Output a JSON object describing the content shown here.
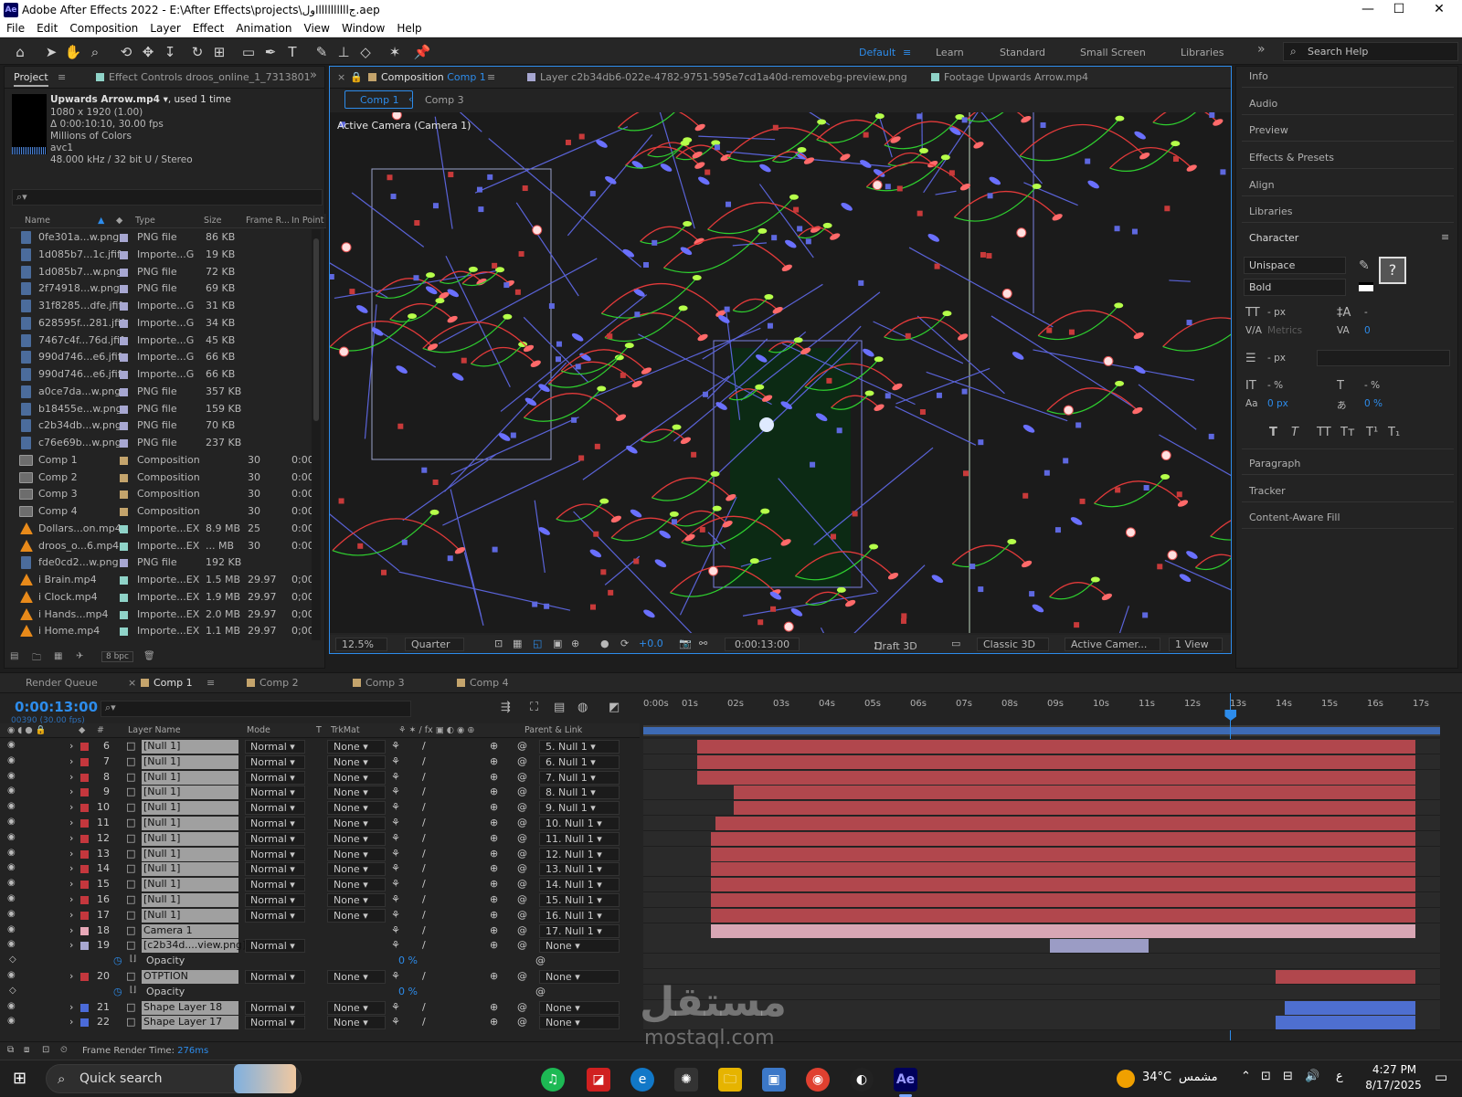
{
  "titlebar": {
    "title": "Adobe After Effects 2022 - E:\\After Effects\\projects\\اولllllllllllج.aep",
    "app_badge": "Ae",
    "minimize": "—",
    "maximize": "☐",
    "close": "✕"
  },
  "menu": [
    "File",
    "Edit",
    "Composition",
    "Layer",
    "Effect",
    "Animation",
    "View",
    "Window",
    "Help"
  ],
  "workspaces": [
    {
      "label": "Default",
      "active": true
    },
    {
      "label": "Learn"
    },
    {
      "label": "Standard"
    },
    {
      "label": "Small Screen"
    },
    {
      "label": "Libraries"
    }
  ],
  "search_help": "Search Help",
  "project": {
    "tab_project": "Project",
    "tab_effects": "Effect Controls droos_online_1_7313801",
    "selected_name": "Upwards Arrow.mp4",
    "used": ", used 1 time",
    "info": [
      "1080 x 1920 (1.00)",
      "Δ 0:00:10:10, 30.00 fps",
      "Millions of Colors",
      "avc1",
      "48.000 kHz / 32 bit U / Stereo"
    ],
    "columns": {
      "name": "Name",
      "type": "Type",
      "size": "Size",
      "frame": "Frame R...",
      "inpoint": "In Point"
    },
    "items": [
      {
        "name": "0fe301a...w.png",
        "type": "PNG file",
        "size": "86 KB",
        "frame": "",
        "inpoint": "",
        "kind": "png",
        "color": "#a7a7d1"
      },
      {
        "name": "1d085b7...1c.jfif",
        "type": "Importe...G",
        "size": "19 KB",
        "frame": "",
        "inpoint": "",
        "kind": "png",
        "color": "#a7a7d1"
      },
      {
        "name": "1d085b7...w.png",
        "type": "PNG file",
        "size": "72 KB",
        "frame": "",
        "inpoint": "",
        "kind": "png",
        "color": "#a7a7d1"
      },
      {
        "name": "2f74918...w.png",
        "type": "PNG file",
        "size": "69 KB",
        "frame": "",
        "inpoint": "",
        "kind": "png",
        "color": "#a7a7d1"
      },
      {
        "name": "31f8285...dfe.jfif",
        "type": "Importe...G",
        "size": "31 KB",
        "frame": "",
        "inpoint": "",
        "kind": "png",
        "color": "#a7a7d1"
      },
      {
        "name": "628595f...281.jfif",
        "type": "Importe...G",
        "size": "34 KB",
        "frame": "",
        "inpoint": "",
        "kind": "png",
        "color": "#a7a7d1"
      },
      {
        "name": "7467c4f...76d.jfif",
        "type": "Importe...G",
        "size": "45 KB",
        "frame": "",
        "inpoint": "",
        "kind": "png",
        "color": "#a7a7d1"
      },
      {
        "name": "990d746...e6.jfif",
        "type": "Importe...G",
        "size": "66 KB",
        "frame": "",
        "inpoint": "",
        "kind": "png",
        "color": "#a7a7d1"
      },
      {
        "name": "990d746...e6.jfif",
        "type": "Importe...G",
        "size": "66 KB",
        "frame": "",
        "inpoint": "",
        "kind": "png",
        "color": "#a7a7d1"
      },
      {
        "name": "a0ce7da...w.png",
        "type": "PNG file",
        "size": "357 KB",
        "frame": "",
        "inpoint": "",
        "kind": "png",
        "color": "#a7a7d1"
      },
      {
        "name": "b18455e...w.png",
        "type": "PNG file",
        "size": "159 KB",
        "frame": "",
        "inpoint": "",
        "kind": "png",
        "color": "#a7a7d1"
      },
      {
        "name": "c2b34db...w.png",
        "type": "PNG file",
        "size": "70 KB",
        "frame": "",
        "inpoint": "",
        "kind": "png",
        "color": "#a7a7d1"
      },
      {
        "name": "c76e69b...w.png",
        "type": "PNG file",
        "size": "237 KB",
        "frame": "",
        "inpoint": "",
        "kind": "png",
        "color": "#a7a7d1"
      },
      {
        "name": "Comp 1",
        "type": "Composition",
        "size": "",
        "frame": "30",
        "inpoint": "0:00",
        "kind": "comp",
        "color": "#c4a46c"
      },
      {
        "name": "Comp 2",
        "type": "Composition",
        "size": "",
        "frame": "30",
        "inpoint": "0:00",
        "kind": "comp",
        "color": "#c4a46c"
      },
      {
        "name": "Comp 3",
        "type": "Composition",
        "size": "",
        "frame": "30",
        "inpoint": "0:00",
        "kind": "comp",
        "color": "#c4a46c"
      },
      {
        "name": "Comp 4",
        "type": "Composition",
        "size": "",
        "frame": "30",
        "inpoint": "0:00",
        "kind": "comp",
        "color": "#c4a46c"
      },
      {
        "name": "Dollars...on.mp4",
        "type": "Importe...EX",
        "size": "8.9 MB",
        "frame": "25",
        "inpoint": "0:00",
        "kind": "vlc",
        "color": "#8fd3c8"
      },
      {
        "name": "droos_o...6.mp4",
        "type": "Importe...EX",
        "size": "... MB",
        "frame": "30",
        "inpoint": "0:00",
        "kind": "vlc",
        "color": "#8fd3c8"
      },
      {
        "name": "fde0cd2...w.png",
        "type": "PNG file",
        "size": "192 KB",
        "frame": "",
        "inpoint": "",
        "kind": "png",
        "color": "#a7a7d1"
      },
      {
        "name": "i Brain.mp4",
        "type": "Importe...EX",
        "size": "1.5 MB",
        "frame": "29.97",
        "inpoint": "0;00",
        "kind": "vlc",
        "color": "#8fd3c8"
      },
      {
        "name": "i Clock.mp4",
        "type": "Importe...EX",
        "size": "1.9 MB",
        "frame": "29.97",
        "inpoint": "0;00",
        "kind": "vlc",
        "color": "#8fd3c8"
      },
      {
        "name": "i Hands...mp4",
        "type": "Importe...EX",
        "size": "2.0 MB",
        "frame": "29.97",
        "inpoint": "0;00",
        "kind": "vlc",
        "color": "#8fd3c8"
      },
      {
        "name": "i Home.mp4",
        "type": "Importe...EX",
        "size": "1.1 MB",
        "frame": "29.97",
        "inpoint": "0;00",
        "kind": "vlc",
        "color": "#8fd3c8"
      }
    ],
    "bpc": "8 bpc"
  },
  "viewer": {
    "tab_comp_prefix": "Composition",
    "tab_comp_name": "Comp 1",
    "tab_layer": "Layer c2b34db6-022e-4782-9751-595e7cd1a40d-removebg-preview.png",
    "tab_footage": "Footage Upwards Arrow.mp4",
    "crumb_active": "Comp 1",
    "crumb_next": "Comp 3",
    "camera_label": "Active Camera (Camera 1)",
    "zoom": "12.5%",
    "resolution": "Quarter",
    "exposure": "+0.0",
    "time": "0:00:13:00",
    "draft3d": "Draft 3D",
    "renderer": "Classic 3D",
    "camera_view": "Active Camer...",
    "views": "1 View"
  },
  "right_panel": {
    "items_top": [
      "Info",
      "Audio",
      "Preview",
      "Effects & Presets",
      "Align",
      "Libraries",
      "Character"
    ],
    "font": "Unispace",
    "style": "Bold",
    "size": "- px",
    "leading": "-",
    "kerning": "Metrics",
    "tracking": "0",
    "stroke": "- px",
    "vscale": "- %",
    "hscale": "- %",
    "baseline": "0 px",
    "tsume": "0 %",
    "styles": [
      "T",
      "T",
      "TT",
      "Tт",
      "T¹",
      "T₁"
    ],
    "items_bottom": [
      "Paragraph",
      "Tracker",
      "Content-Aware Fill"
    ]
  },
  "timeline": {
    "tabs": [
      {
        "label": "Render Queue"
      },
      {
        "label": "Comp 1",
        "active": true
      },
      {
        "label": "Comp 2"
      },
      {
        "label": "Comp 3"
      },
      {
        "label": "Comp 4"
      }
    ],
    "timecode": "0:00:13:00",
    "frames": "00390 (30.00 fps)",
    "ticks": [
      "0:00s",
      "01s",
      "02s",
      "03s",
      "04s",
      "05s",
      "06s",
      "07s",
      "08s",
      "09s",
      "10s",
      "11s",
      "12s",
      "13s",
      "14s",
      "15s",
      "16s",
      "17s"
    ],
    "columns": {
      "hash": "#",
      "layer_name": "Layer Name",
      "mode": "Mode",
      "t": "T",
      "trkmat": "TrkMat",
      "parent": "Parent & Link"
    },
    "duration_seconds": 17.2,
    "playhead_seconds": 13,
    "layers": [
      {
        "num": "6",
        "name": "[Null 1]",
        "mode": "Normal",
        "trk": "None",
        "parent": "5. Null 1",
        "color": "#c4373d",
        "bar_color": "#b1474d",
        "start": 1.2,
        "end": 17.1
      },
      {
        "num": "7",
        "name": "[Null 1]",
        "mode": "Normal",
        "trk": "None",
        "parent": "6. Null 1",
        "color": "#c4373d",
        "bar_color": "#b1474d",
        "start": 1.2,
        "end": 17.1
      },
      {
        "num": "8",
        "name": "[Null 1]",
        "mode": "Normal",
        "trk": "None",
        "parent": "7. Null 1",
        "color": "#c4373d",
        "bar_color": "#b1474d",
        "start": 1.2,
        "end": 17.1
      },
      {
        "num": "9",
        "name": "[Null 1]",
        "mode": "Normal",
        "trk": "None",
        "parent": "8. Null 1",
        "color": "#c4373d",
        "bar_color": "#b1474d",
        "start": 2.0,
        "end": 17.1
      },
      {
        "num": "10",
        "name": "[Null 1]",
        "mode": "Normal",
        "trk": "None",
        "parent": "9. Null 1",
        "color": "#c4373d",
        "bar_color": "#b1474d",
        "start": 2.0,
        "end": 17.1
      },
      {
        "num": "11",
        "name": "[Null 1]",
        "mode": "Normal",
        "trk": "None",
        "parent": "10. Null 1",
        "color": "#c4373d",
        "bar_color": "#b1474d",
        "start": 1.6,
        "end": 17.1
      },
      {
        "num": "12",
        "name": "[Null 1]",
        "mode": "Normal",
        "trk": "None",
        "parent": "11. Null 1",
        "color": "#c4373d",
        "bar_color": "#b1474d",
        "start": 1.5,
        "end": 17.1
      },
      {
        "num": "13",
        "name": "[Null 1]",
        "mode": "Normal",
        "trk": "None",
        "parent": "12. Null 1",
        "color": "#c4373d",
        "bar_color": "#b1474d",
        "start": 1.5,
        "end": 17.1
      },
      {
        "num": "14",
        "name": "[Null 1]",
        "mode": "Normal",
        "trk": "None",
        "parent": "13. Null 1",
        "color": "#c4373d",
        "bar_color": "#b1474d",
        "start": 1.5,
        "end": 17.1
      },
      {
        "num": "15",
        "name": "[Null 1]",
        "mode": "Normal",
        "trk": "None",
        "parent": "14. Null 1",
        "color": "#c4373d",
        "bar_color": "#b1474d",
        "start": 1.5,
        "end": 17.1
      },
      {
        "num": "16",
        "name": "[Null 1]",
        "mode": "Normal",
        "trk": "None",
        "parent": "15. Null 1",
        "color": "#c4373d",
        "bar_color": "#b1474d",
        "start": 1.5,
        "end": 17.1
      },
      {
        "num": "17",
        "name": "[Null 1]",
        "mode": "Normal",
        "trk": "None",
        "parent": "16. Null 1",
        "color": "#c4373d",
        "bar_color": "#b1474d",
        "start": 1.5,
        "end": 17.1
      },
      {
        "num": "18",
        "name": "Camera 1",
        "mode": "",
        "trk": "",
        "parent": "17. Null 1",
        "color": "#e9a9b9",
        "bar_color": "#d8a6b4",
        "start": 1.5,
        "end": 17.1
      },
      {
        "num": "19",
        "name": "[c2b34d....view.png]",
        "mode": "Normal",
        "trk": "",
        "parent": "None",
        "color": "#a7a7d1",
        "bar_color": "#9b9cc5",
        "start": 9.0,
        "end": 11.2
      },
      {
        "prop": "Opacity",
        "value": "0 %"
      },
      {
        "num": "20",
        "name": "OTPTION",
        "mode": "Normal",
        "trk": "None",
        "parent": "None",
        "color": "#c4373d",
        "bar_color": "#b1474d",
        "start": 14.0,
        "end": 17.1
      },
      {
        "prop": "Opacity",
        "value": "0 %"
      },
      {
        "num": "21",
        "name": "Shape Layer 18",
        "mode": "Normal",
        "trk": "None",
        "parent": "None",
        "color": "#4b6bd8",
        "bar_color": "#4e6fd0",
        "start": 14.2,
        "end": 17.1
      },
      {
        "num": "22",
        "name": "Shape Layer 17",
        "mode": "Normal",
        "trk": "None",
        "parent": "None",
        "color": "#4b6bd8",
        "bar_color": "#4e6fd0",
        "start": 14.0,
        "end": 17.1
      }
    ],
    "frame_render_label": "Frame Render Time:",
    "frame_render_value": "276ms"
  },
  "taskbar": {
    "search": "Quick search",
    "weather_temp": "34°C",
    "weather_desc": "مشمس",
    "lang": "ع",
    "clock_time": "4:27 PM",
    "clock_date": "8/17/2025"
  },
  "watermark": {
    "arabic": "مستقل",
    "latin": "mostaql.com"
  }
}
